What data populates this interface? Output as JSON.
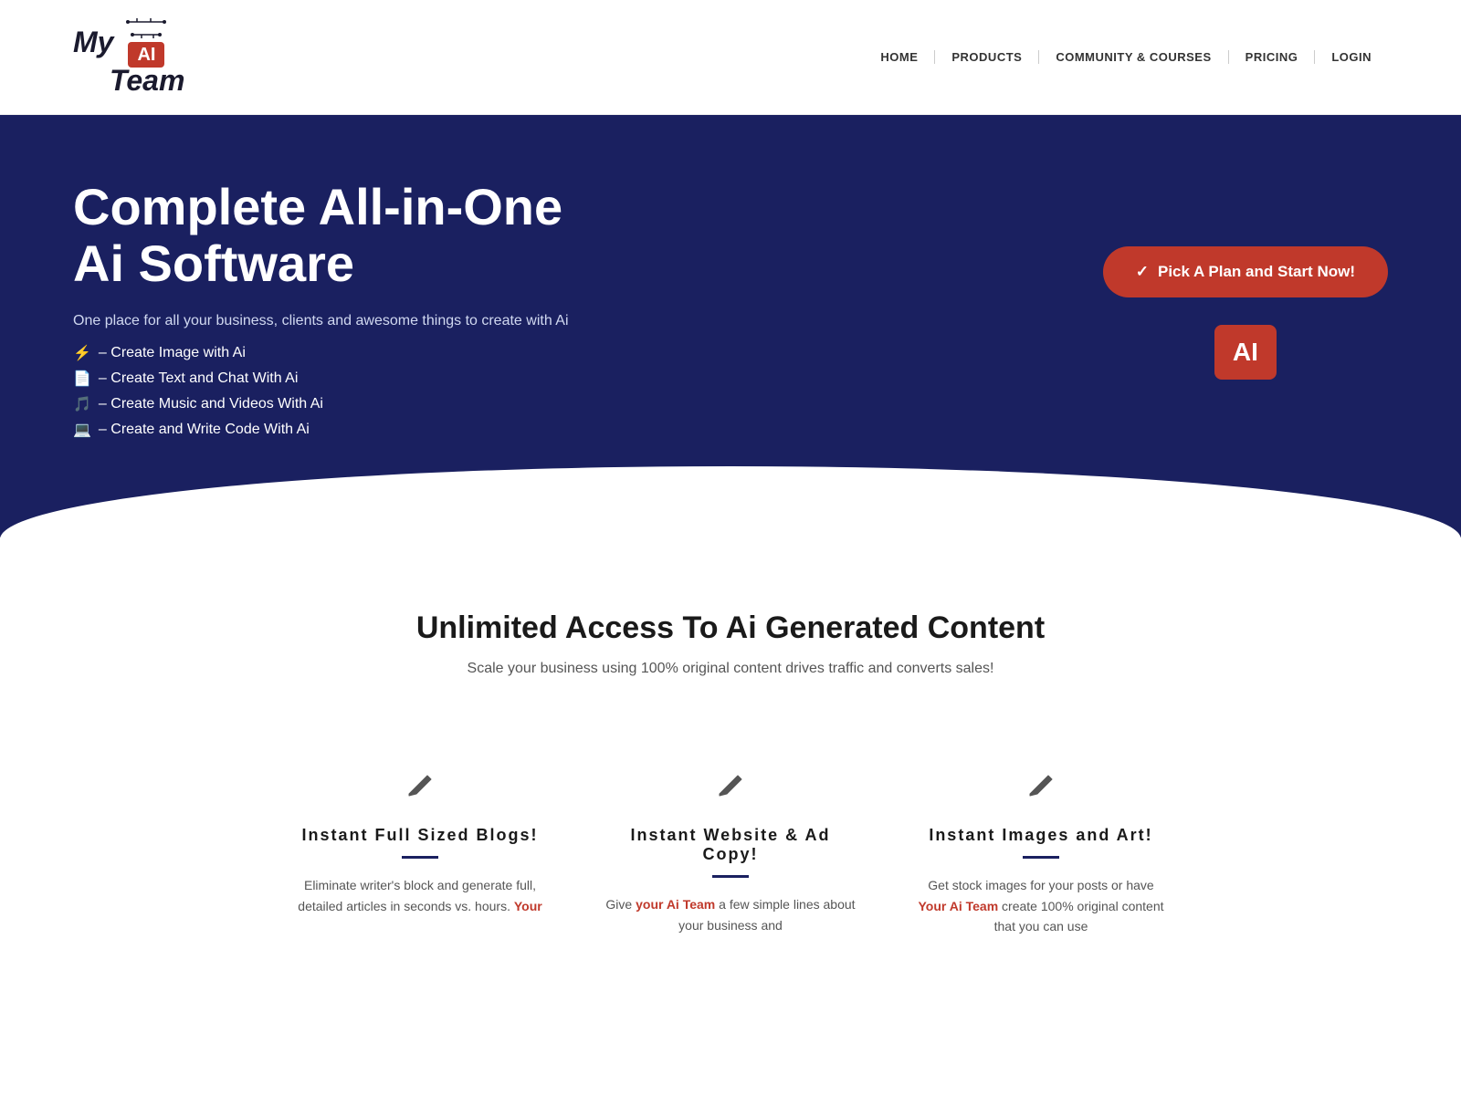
{
  "header": {
    "logo": {
      "text_my": "My",
      "ai_badge": "AI",
      "text_team": "Team"
    },
    "nav": {
      "items": [
        {
          "label": "HOME",
          "id": "home"
        },
        {
          "label": "PRODUCTS",
          "id": "products"
        },
        {
          "label": "COMMUNITY & COURSES",
          "id": "community"
        },
        {
          "label": "PRICING",
          "id": "pricing"
        },
        {
          "label": "LOGIN",
          "id": "login"
        }
      ]
    }
  },
  "hero": {
    "title": "Complete All-in-One Ai Software",
    "subtitle": "One place for all your business, clients and awesome things to create with Ai",
    "features": [
      {
        "icon": "⚡",
        "text": "– Create Image with Ai"
      },
      {
        "icon": "📄",
        "text": "– Create Text and Chat With Ai"
      },
      {
        "icon": "🎵",
        "text": "– Create Music and Videos With Ai"
      },
      {
        "icon": "💻",
        "text": "– Create and Write Code With Ai"
      }
    ],
    "cta_button": "Pick A Plan and Start Now!",
    "ai_badge": "AI"
  },
  "unlimited_section": {
    "title": "Unlimited Access To Ai Generated Content",
    "subtitle": "Scale your business using 100% original content drives traffic and converts sales!"
  },
  "cards": [
    {
      "icon": "✏",
      "title": "Instant Full Sized Blogs!",
      "desc_parts": [
        {
          "text": "Eliminate writer's block and generate full, detailed articles in seconds vs. hours. ",
          "highlight": false
        },
        {
          "text": "Your",
          "highlight": true
        }
      ]
    },
    {
      "icon": "✏",
      "title": "Instant Website & Ad Copy!",
      "desc_parts": [
        {
          "text": "Give ",
          "highlight": false
        },
        {
          "text": "your Ai Team",
          "highlight": true
        },
        {
          "text": " a few simple lines about your business and",
          "highlight": false
        }
      ]
    },
    {
      "icon": "✏",
      "title": "Instant Images and Art!",
      "desc_parts": [
        {
          "text": "Get stock images for your posts or have ",
          "highlight": false
        },
        {
          "text": "Your Ai Team",
          "highlight": true
        },
        {
          "text": " create 100% original content that you can use",
          "highlight": false
        }
      ]
    }
  ]
}
